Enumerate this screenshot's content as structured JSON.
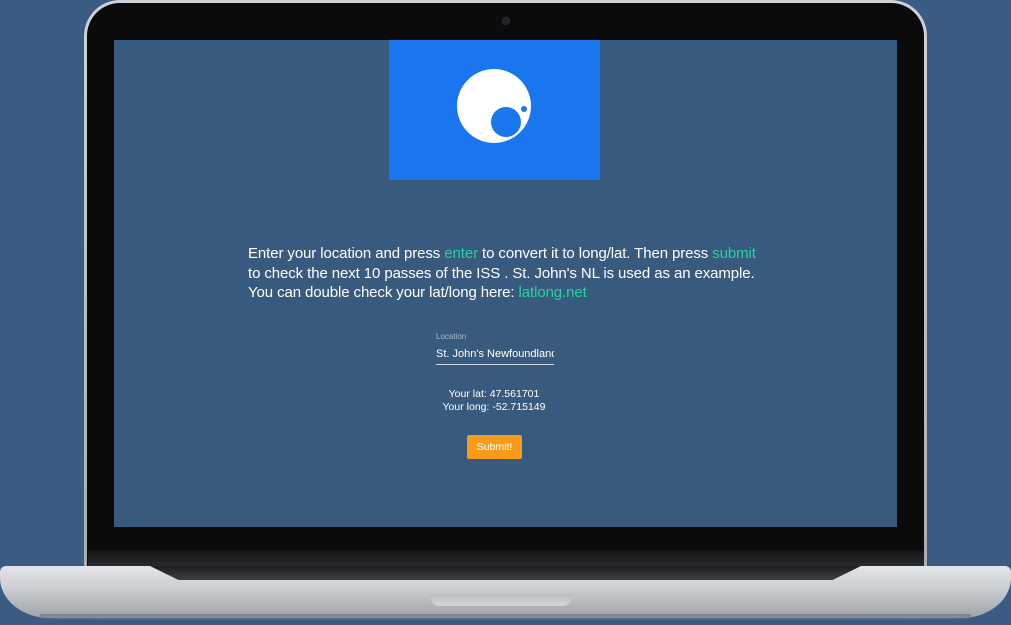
{
  "intro": {
    "part1": "Enter your location and press ",
    "enter_link": "enter",
    "part2": " to convert it to long/lat. Then press ",
    "submit_link": "submit",
    "part3": " to check the next 10 passes of the ISS . St. John's NL is used as an example. You can double check your lat/long here: ",
    "latlong_link": "latlong.net"
  },
  "location": {
    "label": "Location",
    "value": "St. John's Newfoundland"
  },
  "coords": {
    "lat_text": "Your lat: 47.561701",
    "long_text": "Your long: -52.715149"
  },
  "submit_button": {
    "label": "Submit!"
  },
  "icons": {
    "logo": "iss-logo-icon",
    "camera": "webcam-icon"
  },
  "colors": {
    "background": "#3a5b82",
    "logo_blue": "#1976ee",
    "accent_green": "#23d3a0",
    "button_orange": "#f79c18"
  }
}
